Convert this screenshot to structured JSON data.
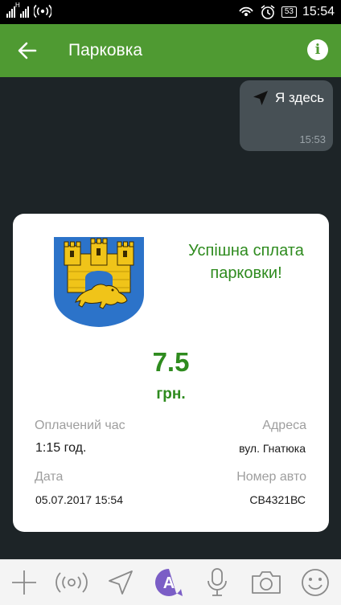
{
  "status_bar": {
    "time": "15:54",
    "battery": "53"
  },
  "header": {
    "title": "Парковка"
  },
  "chat": {
    "message": {
      "text": "Я здесь",
      "time": "15:53"
    }
  },
  "receipt": {
    "title": "Успішна сплата парковки!",
    "amount": "7.5",
    "currency": "грн.",
    "paid_time_label": "Оплачений час",
    "paid_time_value": "1:15 год.",
    "address_label": "Адреса",
    "address_value": "вул. Гнатюка",
    "date_label": "Дата",
    "date_value": "05.07.2017 15:54",
    "car_label": "Номер авто",
    "car_value": "СВ4321ВС"
  },
  "input_bar": {
    "icons": [
      "plus-icon",
      "broadcast-icon",
      "location-icon",
      "sticker-icon",
      "microphone-icon",
      "camera-icon",
      "emoji-icon"
    ],
    "sticker_letter": "A"
  },
  "colors": {
    "brand_green": "#4f9a32",
    "success_green": "#2e8b1e",
    "chat_bg": "#1d2427"
  }
}
